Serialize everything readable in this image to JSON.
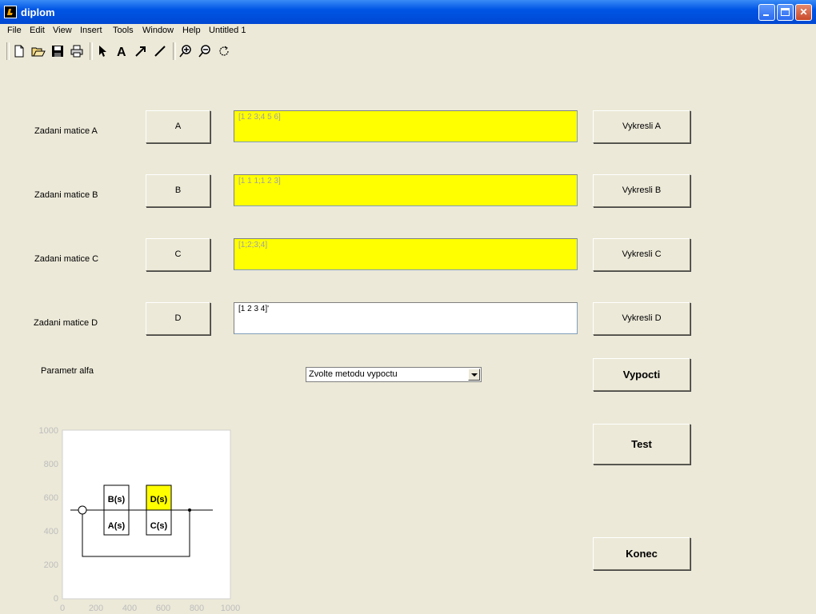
{
  "window": {
    "title": "diplom"
  },
  "menu": [
    "File",
    "Edit",
    "View",
    "Insert",
    "Tools",
    "Window",
    "Help",
    "Untitled 1"
  ],
  "toolbar": [
    "new-file-icon",
    "open-folder-icon",
    "save-icon",
    "print-icon",
    "pointer-icon",
    "text-icon",
    "arrow-icon",
    "line-icon",
    "zoom-in-icon",
    "zoom-out-icon",
    "rotate-icon"
  ],
  "rows": [
    {
      "label": "Zadani matice A",
      "button": "A",
      "field": "[1 2 3;4 5 6]",
      "plot_button": "Vykresli A"
    },
    {
      "label": "Zadani matice B",
      "button": "B",
      "field": "[1 1 1;1 2 3]",
      "plot_button": "Vykresli B"
    },
    {
      "label": "Zadani matice C",
      "button": "C",
      "field": "[1;2;3;4]",
      "plot_button": "Vykresli C"
    },
    {
      "label": "Zadani matice D",
      "button": "D",
      "field": "[1 2 3 4]'",
      "plot_button": "Vykresli D"
    }
  ],
  "alpha_label": "Parametr alfa",
  "method_select": {
    "value": "Zvolte metodu vypoctu"
  },
  "buttons": {
    "compute": "Vypocti",
    "test": "Test",
    "end": "Konec"
  },
  "colors": {
    "highlight": "#ffff00",
    "background": "#ece9d8"
  },
  "axes": {
    "x_ticks": [
      "0",
      "200",
      "400",
      "600",
      "800",
      "1000"
    ],
    "y_ticks": [
      "1000",
      "800",
      "600",
      "400",
      "200",
      "0"
    ],
    "blocks": [
      "B(s)",
      "A(s)",
      "D(s)",
      "C(s)"
    ]
  }
}
